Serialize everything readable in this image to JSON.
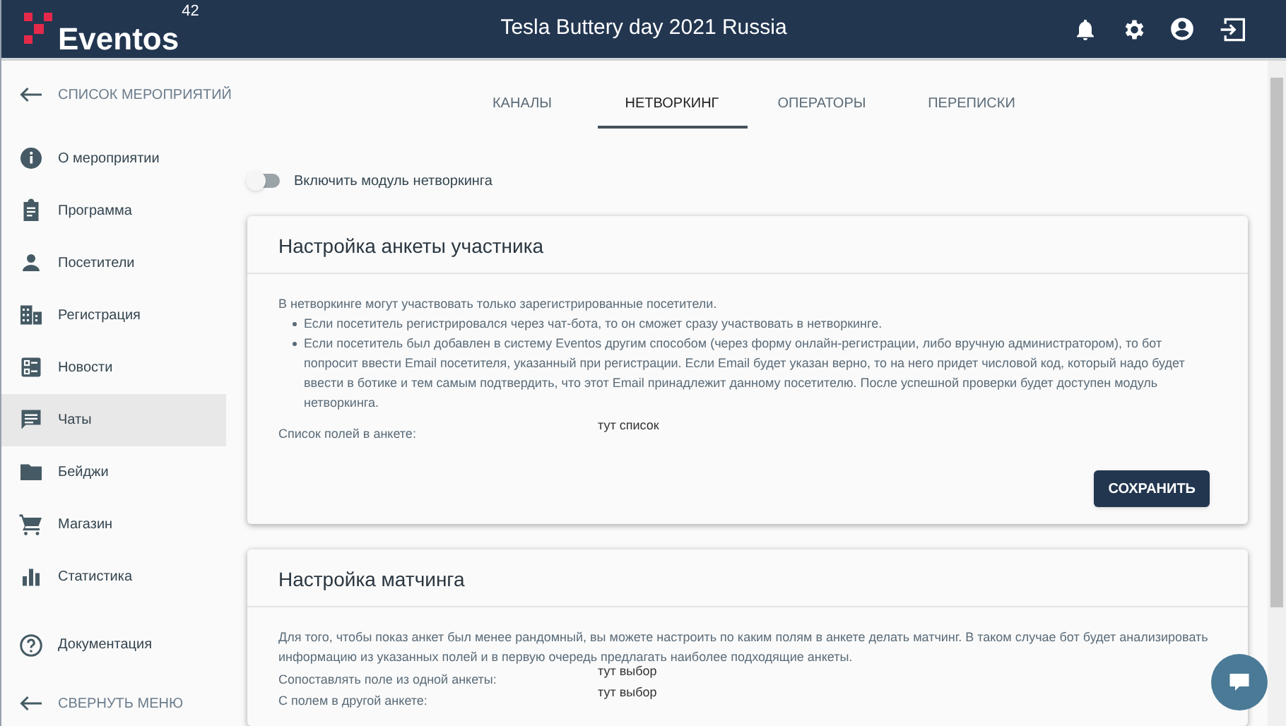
{
  "app": {
    "logo": "Eventos",
    "logo_superscript": "42"
  },
  "header": {
    "title": "Tesla Buttery day 2021 Russia"
  },
  "sidebar": {
    "back_link": "СПИСОК МЕРОПРИЯТИЙ",
    "items": [
      {
        "label": "О мероприятии",
        "selected": false
      },
      {
        "label": "Программа",
        "selected": false
      },
      {
        "label": "Посетители",
        "selected": false
      },
      {
        "label": "Регистрация",
        "selected": false
      },
      {
        "label": "Новости",
        "selected": false
      },
      {
        "label": "Чаты",
        "selected": true
      },
      {
        "label": "Бейджи",
        "selected": false
      },
      {
        "label": "Магазин",
        "selected": false
      },
      {
        "label": "Статистика",
        "selected": false
      }
    ],
    "documentation": "Документация",
    "collapse": "СВЕРНУТЬ МЕНЮ"
  },
  "tabs": [
    {
      "label": "КАНАЛЫ",
      "selected": false
    },
    {
      "label": "НЕТВОРКИНГ",
      "selected": true
    },
    {
      "label": "ОПЕРАТОРЫ",
      "selected": false
    },
    {
      "label": "ПЕРЕПИСКИ",
      "selected": false
    }
  ],
  "networking_toggle": {
    "label": "Включить модуль нетворкинга",
    "on": false
  },
  "cards": [
    {
      "title": "Настройка анкеты участника",
      "intro": "В нетворкинге могут участвовать только зарегистрированные посетители.",
      "bullets": [
        "Если посетитель регистрировался через чат-бота, то он сможет сразу участвовать в нетворкинге.",
        "Если посетитель был добавлен в систему Eventos другим способом (через форму онлайн-регистрации, либо вручную администратором), то бот попросит ввести Email посетителя, указанный при регистрации. Если Email будет указан верно, то на него придет числовой код, который надо будет ввести в ботике и тем самым подтвердить, что этот Email принадлежит данному посетителю. После успешной проверки будет доступен модуль нетворкинга."
      ],
      "fields": [
        {
          "label": "Список полей в анкете:",
          "value": "тут список"
        }
      ],
      "button": "СОХРАНИТЬ"
    },
    {
      "title": "Настройка матчинга",
      "intro": "Для того, чтобы показ анкет был менее рандомный, вы можете настроить по каким полям в анкете делать матчинг. В таком случае бот будет анализировать информацию из указанных полей и в первую очередь предлагать наиболее подходящие анкеты.",
      "fields": [
        {
          "label": "Сопоставлять поле из одной анкеты:",
          "value": "тут выбор"
        },
        {
          "label": "С полем в другой анкете:",
          "value": "тут выбор"
        }
      ]
    }
  ]
}
